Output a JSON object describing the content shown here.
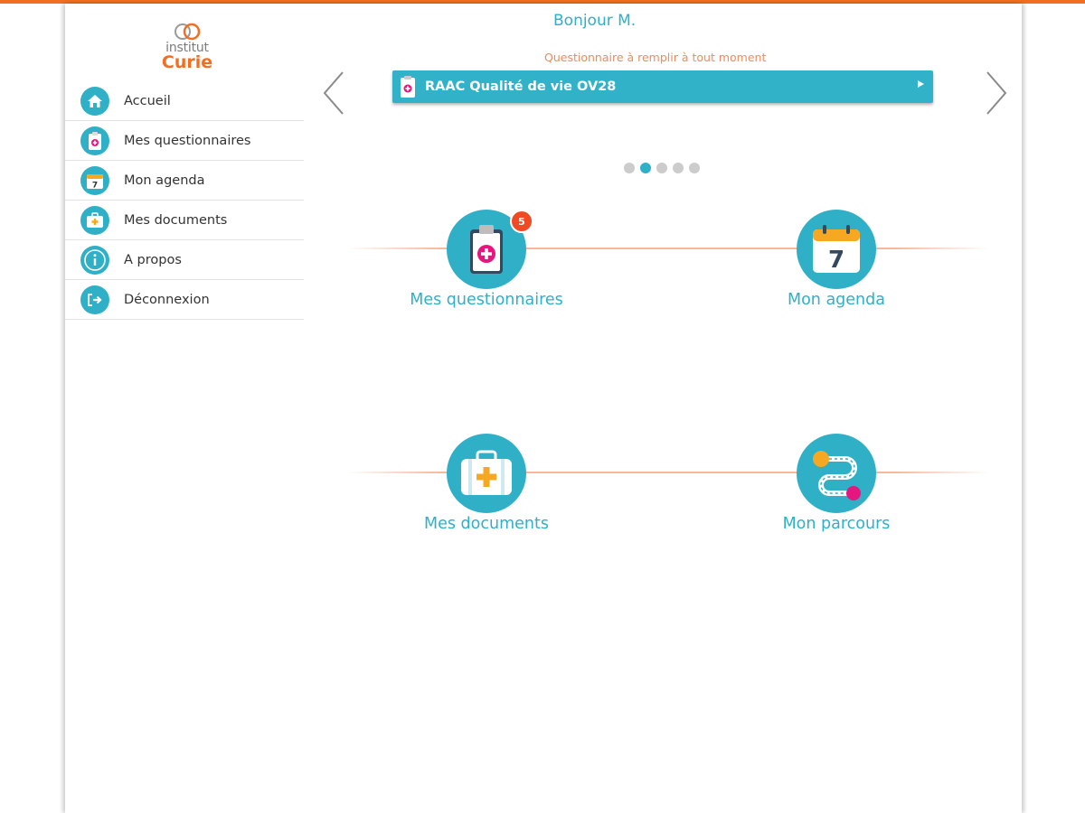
{
  "brand": {
    "line1": "institut",
    "line2": "Curie"
  },
  "sidebar": {
    "items": [
      {
        "label": "Accueil",
        "icon": "home-icon"
      },
      {
        "label": "Mes questionnaires",
        "icon": "clipboard-icon"
      },
      {
        "label": "Mon agenda",
        "icon": "calendar-icon"
      },
      {
        "label": "Mes documents",
        "icon": "medical-case-icon"
      },
      {
        "label": "A propos",
        "icon": "info-icon"
      },
      {
        "label": "Déconnexion",
        "icon": "logout-icon"
      }
    ]
  },
  "header": {
    "greeting": "Bonjour M.",
    "subtitle": "Questionnaire à remplir à tout moment"
  },
  "carousel": {
    "banner_label": "RAAC Qualité de vie OV28",
    "dots_total": 5,
    "active_dot": 2
  },
  "tiles": [
    {
      "label": "Mes questionnaires",
      "icon": "clipboard-icon",
      "badge": "5"
    },
    {
      "label": "Mon agenda",
      "icon": "calendar-icon",
      "day": "7"
    },
    {
      "label": "Mes documents",
      "icon": "medical-case-icon"
    },
    {
      "label": "Mon parcours",
      "icon": "path-icon"
    }
  ],
  "colors": {
    "accent": "#2fb0c7",
    "brand_orange": "#f26e22",
    "badge": "#ef4a23",
    "pink": "#e5177e"
  }
}
